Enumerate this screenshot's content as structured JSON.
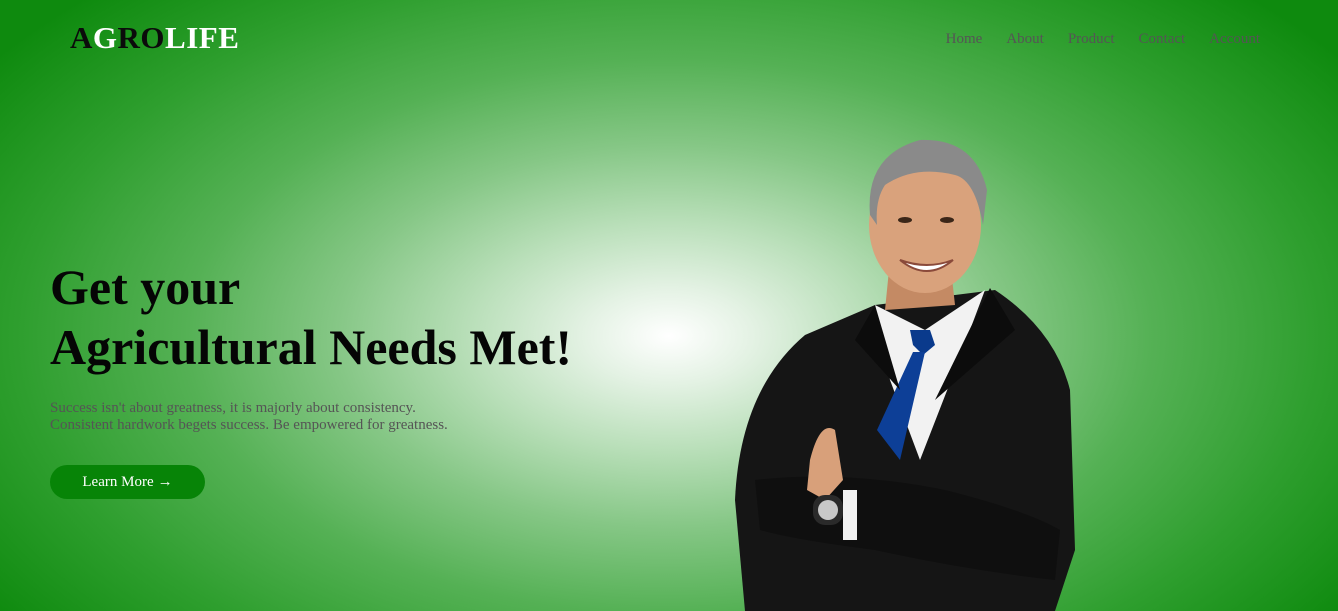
{
  "logo": {
    "parts": [
      {
        "text": "A",
        "tone": "dark"
      },
      {
        "text": "G",
        "tone": "light"
      },
      {
        "text": "RO",
        "tone": "dark"
      },
      {
        "text": "LIFE",
        "tone": "light"
      }
    ]
  },
  "nav": {
    "items": [
      {
        "label": "Home"
      },
      {
        "label": "About"
      },
      {
        "label": "Product"
      },
      {
        "label": "Contact"
      },
      {
        "label": "Account"
      }
    ]
  },
  "hero": {
    "title_line1": "Get your",
    "title_line2": "Agricultural Needs Met!",
    "subtitle_line1": "Success isn't about greatness, it is majorly about consistency.",
    "subtitle_line2": "Consistent hardwork begets success. Be empowered for greatness.",
    "cta_label": "Learn More",
    "cta_icon": "arrow-right-icon"
  },
  "colors": {
    "brand_green": "#078407",
    "nav_text": "#555555",
    "title_text": "#050505"
  }
}
